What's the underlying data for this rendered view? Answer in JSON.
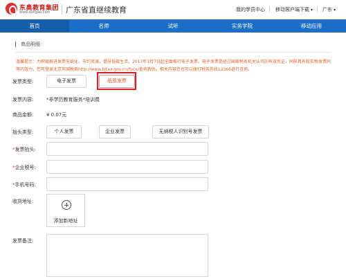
{
  "header": {
    "logo_cn": "东奥教育集团",
    "logo_en": "www.dongao.com",
    "site_title": "广东省直继续教育",
    "links": {
      "my_center": "我的学员中心",
      "mobile_download": "移动客户端下载",
      "region": "广东"
    }
  },
  "nav": {
    "items": [
      "首页",
      "名师",
      "试听",
      "实务学院",
      "移动应用"
    ],
    "active_index": 0
  },
  "section": {
    "title": "商品明细"
  },
  "notice": {
    "text": "温馨提示：为积极推进发票无纸化，节约资源，倡导低碳生活，2017年3月7日起全面推行电子发票。电子发票是经过国家税务机关认可的有效凭证，同样具有和实物发票同等的效力，您可登录北京市国税局http://www.bjtax.gov.cn/fpcx/查询真伪。相关内容您也可以拨打税务热线12366进行咨询。"
  },
  "invoice": {
    "type_label": "发票类型:",
    "type_options": [
      "电子发票",
      "纸质发票"
    ],
    "type_selected": "纸质发票",
    "content_label": "发票内容:",
    "content_value": "*非学历教育服务*培训费",
    "amount_label": "商品金额:",
    "amount_value": "¥ 0.07元",
    "title_type_label": "抬头类型:",
    "title_type_options": [
      "个人发票",
      "企业发票",
      "无纳税人识别号发票"
    ],
    "header_label": "发票抬头:",
    "tax_id_label": "企业税号:",
    "phone_label": "手机号码:",
    "address_label": "收货地址:",
    "add_address": "添加新地址",
    "remark_label": "发票备注:",
    "required_mark": "*"
  },
  "colors": {
    "nav_blue": "#1b6fc8",
    "notice_orange": "#e0622a",
    "highlight_red": "#e02020"
  }
}
